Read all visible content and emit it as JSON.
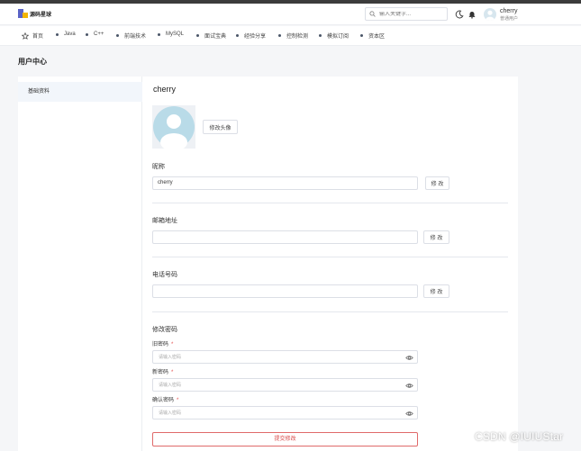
{
  "header": {
    "logo_text": "源码星球",
    "search_placeholder": "输入关键字...",
    "user_name": "cherry",
    "user_role": "普通用户"
  },
  "nav": {
    "items": [
      {
        "label": "首页",
        "icon": "star-icon"
      },
      {
        "label": "Java"
      },
      {
        "label": "C++"
      },
      {
        "label": "前端技术"
      },
      {
        "label": "MySQL"
      },
      {
        "label": "面试宝典"
      },
      {
        "label": "经验分享"
      },
      {
        "label": "控制检测"
      },
      {
        "label": "模拟订阅"
      },
      {
        "label": "资本区"
      }
    ]
  },
  "page": {
    "title": "用户中心"
  },
  "sidebar": {
    "items": [
      {
        "label": "基础资料"
      }
    ]
  },
  "profile": {
    "name": "cherry",
    "avatar_button": "修改头像",
    "nickname_label": "昵称",
    "nickname_value": "cherry",
    "nickname_button": "修 改",
    "email_label": "邮箱地址",
    "email_value": "",
    "email_button": "修 改",
    "phone_label": "电话号码",
    "phone_value": "",
    "phone_button": "修 改"
  },
  "password": {
    "section_label": "修改密码",
    "old_label": "旧密码",
    "new_label": "新密码",
    "confirm_label": "确认密码",
    "required_mark": "*",
    "placeholder": "请输入密码",
    "submit": "提交修改"
  },
  "watermark": "CSDN @IUIUStar",
  "colors": {
    "accent": "#d84848",
    "sidebar_active_bg": "#f2f6fb",
    "avatar_bg": "#b9dbe8"
  }
}
